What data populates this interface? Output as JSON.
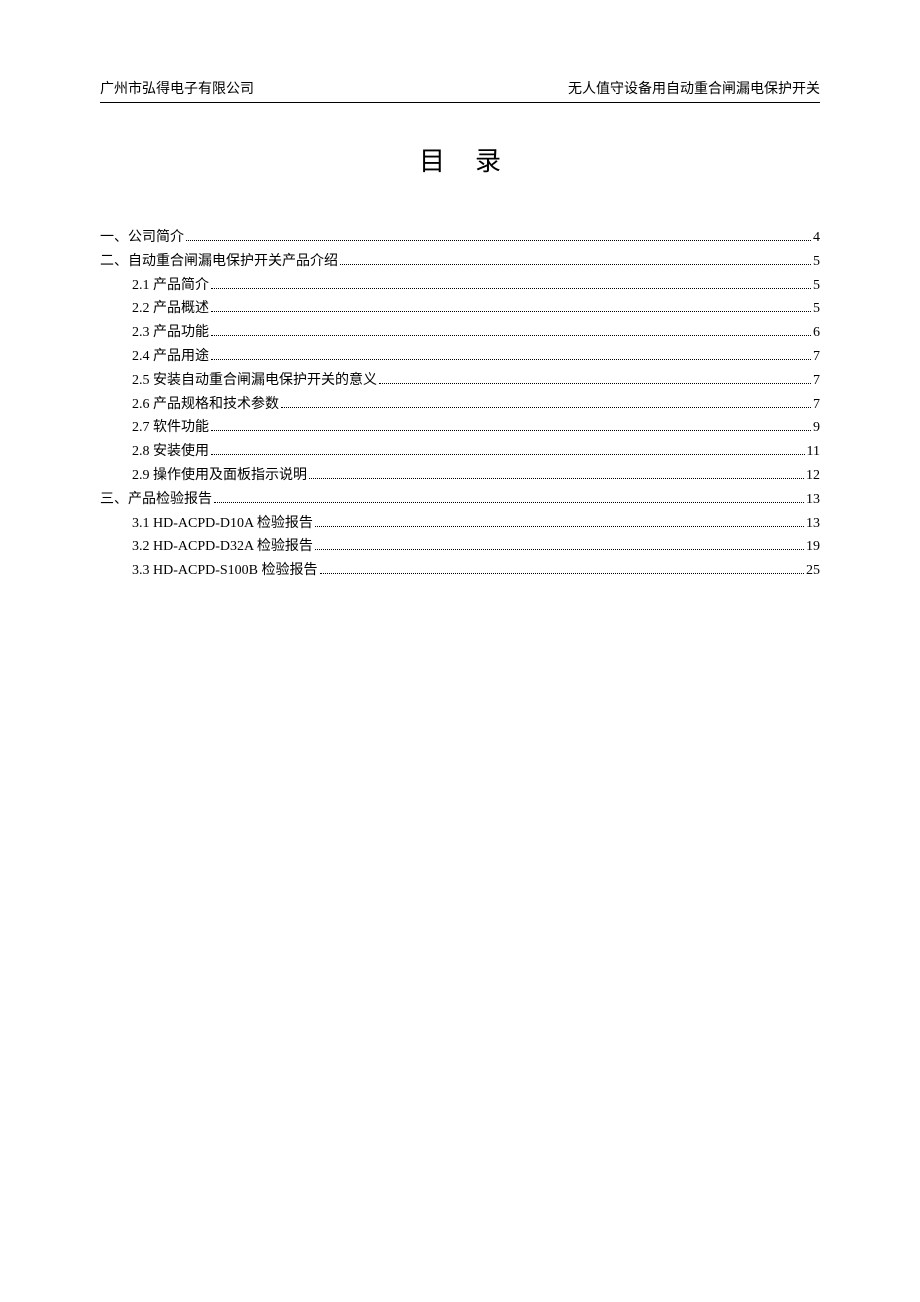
{
  "header": {
    "left": "广州市弘得电子有限公司",
    "right": "无人值守设备用自动重合闸漏电保护开关"
  },
  "title": "目录",
  "toc": [
    {
      "level": 1,
      "label": "一、公司简介",
      "page": "4"
    },
    {
      "level": 1,
      "label": "二、自动重合闸漏电保护开关产品介绍",
      "page": "5"
    },
    {
      "level": 2,
      "label": "2.1  产品简介",
      "page": "5"
    },
    {
      "level": 2,
      "label": "2.2  产品概述",
      "page": "5"
    },
    {
      "level": 2,
      "label": "2.3  产品功能",
      "page": "6"
    },
    {
      "level": 2,
      "label": "2.4  产品用途",
      "page": "7"
    },
    {
      "level": 2,
      "label": "2.5  安装自动重合闸漏电保护开关的意义",
      "page": "7"
    },
    {
      "level": 2,
      "label": "2.6  产品规格和技术参数",
      "page": "7"
    },
    {
      "level": 2,
      "label": "2.7  软件功能",
      "page": "9"
    },
    {
      "level": 2,
      "label": "2.8  安装使用",
      "page": "11"
    },
    {
      "level": 2,
      "label": "2.9  操作使用及面板指示说明",
      "page": "12"
    },
    {
      "level": 1,
      "label": "三、产品检验报告",
      "page": "13"
    },
    {
      "level": 2,
      "label": "3.1 HD-ACPD-D10A 检验报告",
      "page": "13"
    },
    {
      "level": 2,
      "label": "3.2 HD-ACPD-D32A 检验报告",
      "page": "19"
    },
    {
      "level": 2,
      "label": "3.3 HD-ACPD-S100B 检验报告",
      "page": "25"
    }
  ]
}
